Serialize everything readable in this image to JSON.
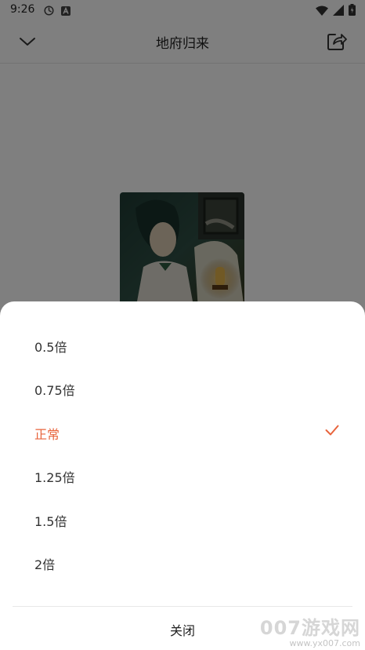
{
  "status_bar": {
    "time": "9:26"
  },
  "header": {
    "title": "地府归来"
  },
  "speed_options": [
    {
      "label": "0.5倍",
      "selected": false
    },
    {
      "label": "0.75倍",
      "selected": false
    },
    {
      "label": "正常",
      "selected": true
    },
    {
      "label": "1.25倍",
      "selected": false
    },
    {
      "label": "1.5倍",
      "selected": false
    },
    {
      "label": "2倍",
      "selected": false
    }
  ],
  "sheet": {
    "close_label": "关闭"
  },
  "colors": {
    "accent": "#e8643c",
    "overlay": "rgba(0,0,0,0.5)"
  },
  "watermark": {
    "main": "007游戏网",
    "url": "www.yx007.com"
  }
}
